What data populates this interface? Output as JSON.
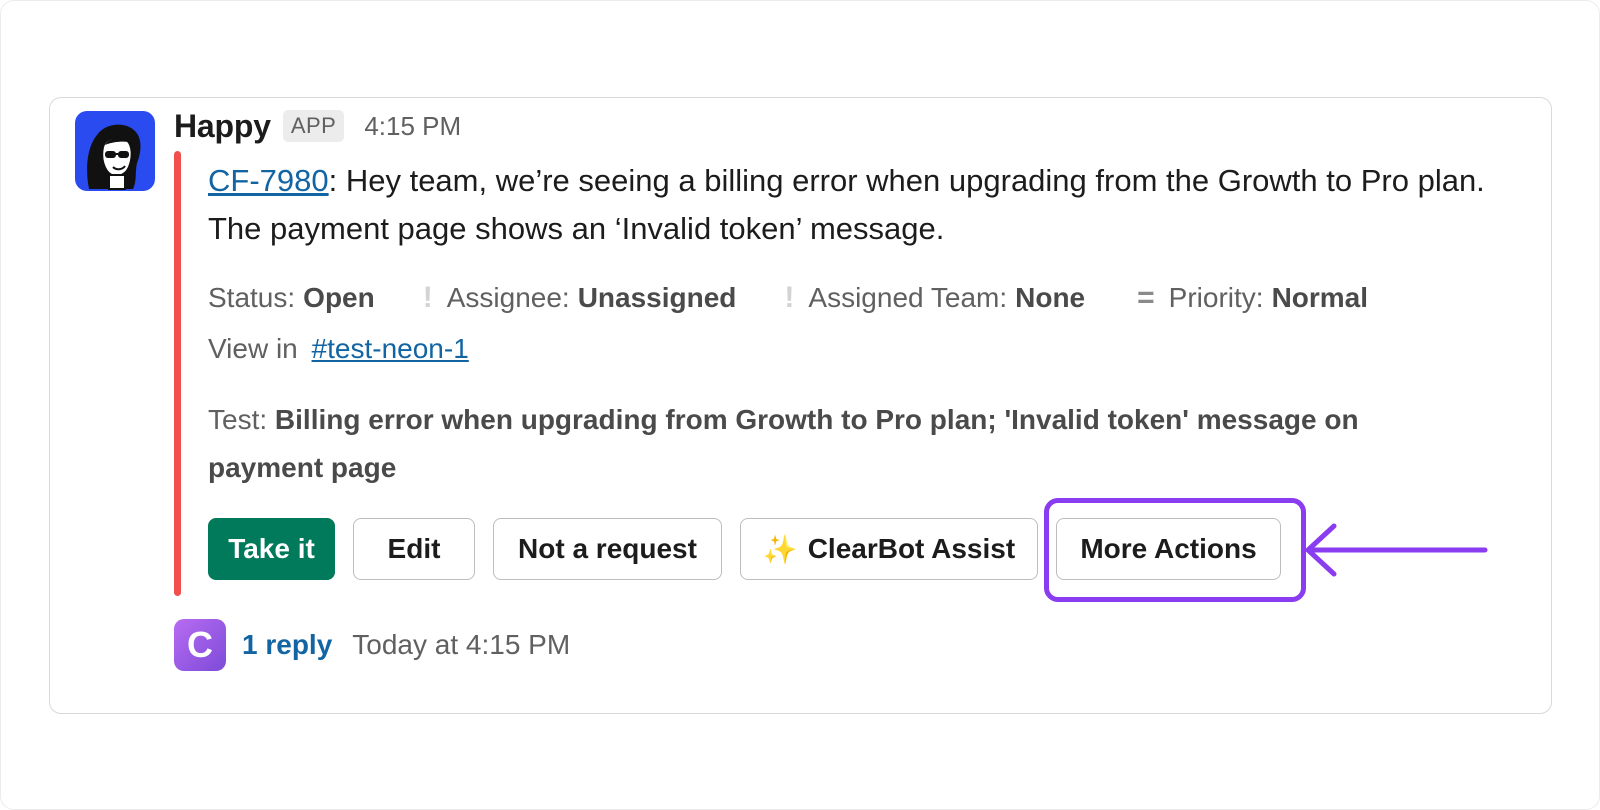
{
  "message": {
    "sender": "Happy",
    "app_badge": "APP",
    "time": "4:15 PM",
    "ticket_id": "CF-7980",
    "body": ":  Hey team, we’re seeing a billing error when upgrading from the Growth to Pro plan. The payment page shows an ‘Invalid token’ message."
  },
  "fields": {
    "status_label": "Status:",
    "status_value": "Open",
    "assignee_label": "Assignee:",
    "assignee_value": "Unassigned",
    "team_label": "Assigned Team:",
    "team_value": "None",
    "priority_label": "Priority:",
    "priority_value": "Normal"
  },
  "view_in": {
    "label": "View in",
    "channel": "#test-neon-1"
  },
  "test": {
    "label": "Test:",
    "value": "Billing error when upgrading from Growth to Pro plan; 'Invalid token' message on payment page"
  },
  "buttons": {
    "take_it": "Take it",
    "edit": "Edit",
    "not_request": "Not a request",
    "clearbot_icon": "✨",
    "clearbot": "ClearBot Assist",
    "more_actions": "More Actions"
  },
  "thread": {
    "avatar_letter": "C",
    "reply_count": "1 reply",
    "reply_time": "Today at 4:15 PM"
  },
  "colors": {
    "accent_bar": "#f24e4e",
    "primary_button": "#007a5a",
    "link": "#1264a3",
    "highlight": "#8a3cf0",
    "avatar_bg": "#2a4bf0"
  },
  "icons": {
    "assignee_sep": "exclamation-icon",
    "team_sep": "exclamation-icon",
    "priority": "equals-icon",
    "highlight_arrow": "arrow-left-icon"
  }
}
